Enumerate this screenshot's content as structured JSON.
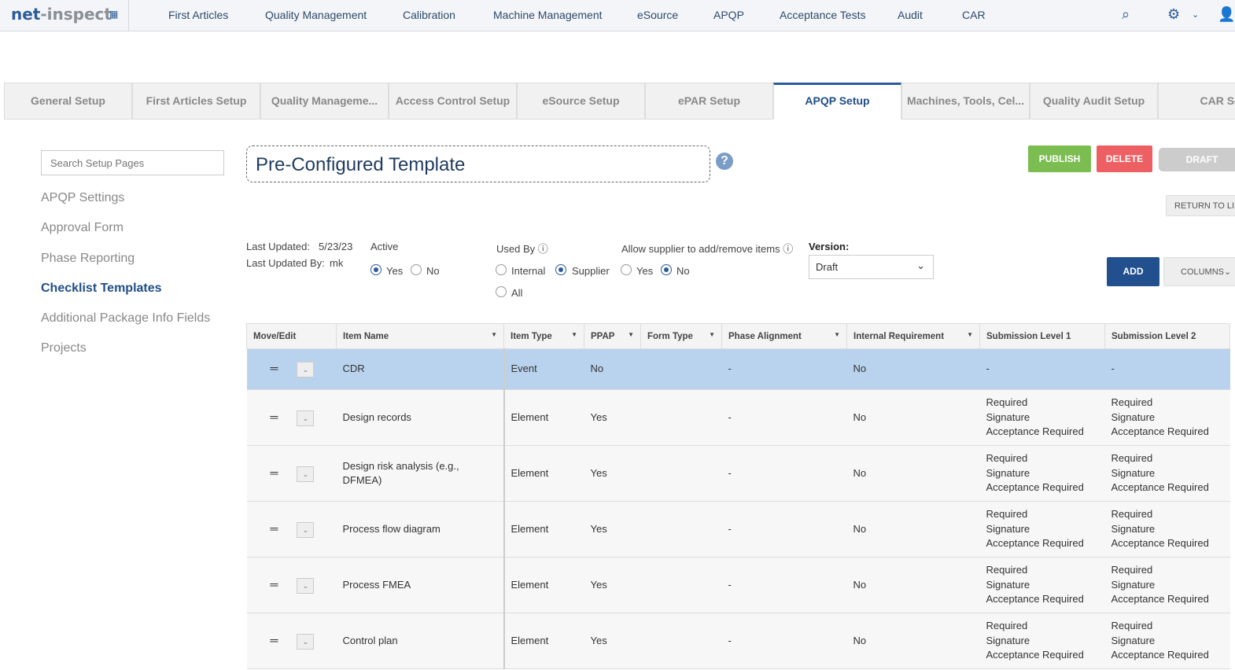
{
  "header": {
    "logo_a": "net",
    "logo_b": "-inspect",
    "nav": [
      "First Articles",
      "Quality Management",
      "Calibration",
      "Machine Management",
      "eSource",
      "APQP",
      "Acceptance Tests",
      "Audit",
      "CAR"
    ]
  },
  "tabs": [
    "General Setup",
    "First Articles Setup",
    "Quality Manageme...",
    "Access Control Setup",
    "eSource Setup",
    "ePAR Setup",
    "APQP Setup",
    "Machines, Tools, Cel...",
    "Quality Audit Setup",
    "CAR Set"
  ],
  "active_tab": 6,
  "sidebar": {
    "search_placeholder": "Search Setup Pages",
    "items": [
      "APQP Settings",
      "Approval Form",
      "Phase Reporting",
      "Checklist Templates",
      "Additional Package Info Fields",
      "Projects"
    ],
    "active": 3
  },
  "template": {
    "title": "Pre-Configured Template"
  },
  "buttons": {
    "publish": "PUBLISH",
    "delete": "DELETE",
    "draft": "DRAFT",
    "return": "RETURN TO LIS",
    "add": "ADD",
    "columns": "COLUMNS"
  },
  "colors": {
    "publish": "#7cbd52",
    "delete": "#ee5f63",
    "draft": "#cccccc",
    "add": "#22508e",
    "accent": "#2b5b9a"
  },
  "meta": {
    "last_updated_label": "Last Updated:",
    "last_updated": "5/23/23",
    "last_updated_by_label": "Last Updated By:",
    "last_updated_by": "mk"
  },
  "active": {
    "label": "Active",
    "yes": "Yes",
    "no": "No",
    "value": "Yes"
  },
  "used_by": {
    "label": "Used By",
    "internal": "Internal",
    "supplier": "Supplier",
    "all": "All",
    "value": "Supplier"
  },
  "allow_supplier": {
    "label": "Allow supplier to add/remove items",
    "yes": "Yes",
    "no": "No",
    "value": "No"
  },
  "version": {
    "label": "Version:",
    "value": "Draft"
  },
  "table": {
    "columns": [
      "Move/Edit",
      "Item Name",
      "Item Type",
      "PPAP",
      "Form Type",
      "Phase Alignment",
      "Internal Requirement",
      "Submission Level 1",
      "Submission Level 2"
    ],
    "rows": [
      {
        "name": "CDR",
        "type": "Event",
        "ppap": "No",
        "form": "",
        "phase": "-",
        "internal": "No",
        "sl1": [
          "-"
        ],
        "sl2": [
          "-"
        ]
      },
      {
        "name": "Design records",
        "type": "Element",
        "ppap": "Yes",
        "form": "",
        "phase": "-",
        "internal": "No",
        "sl1": [
          "Required",
          "Signature",
          "Acceptance Required"
        ],
        "sl2": [
          "Required",
          "Signature",
          "Acceptance Required"
        ]
      },
      {
        "name": "Design risk analysis (e.g., DFMEA)",
        "type": "Element",
        "ppap": "Yes",
        "form": "",
        "phase": "-",
        "internal": "No",
        "sl1": [
          "Required",
          "Signature",
          "Acceptance Required"
        ],
        "sl2": [
          "Required",
          "Signature",
          "Acceptance Required"
        ]
      },
      {
        "name": "Process flow diagram",
        "type": "Element",
        "ppap": "Yes",
        "form": "",
        "phase": "-",
        "internal": "No",
        "sl1": [
          "Required",
          "Signature",
          "Acceptance Required"
        ],
        "sl2": [
          "Required",
          "Signature",
          "Acceptance Required"
        ]
      },
      {
        "name": "Process FMEA",
        "type": "Element",
        "ppap": "Yes",
        "form": "",
        "phase": "-",
        "internal": "No",
        "sl1": [
          "Required",
          "Signature",
          "Acceptance Required"
        ],
        "sl2": [
          "Required",
          "Signature",
          "Acceptance Required"
        ]
      },
      {
        "name": "Control plan",
        "type": "Element",
        "ppap": "Yes",
        "form": "",
        "phase": "-",
        "internal": "No",
        "sl1": [
          "Required",
          "Signature",
          "Acceptance Required"
        ],
        "sl2": [
          "Required",
          "Signature",
          "Acceptance Required"
        ]
      }
    ]
  }
}
